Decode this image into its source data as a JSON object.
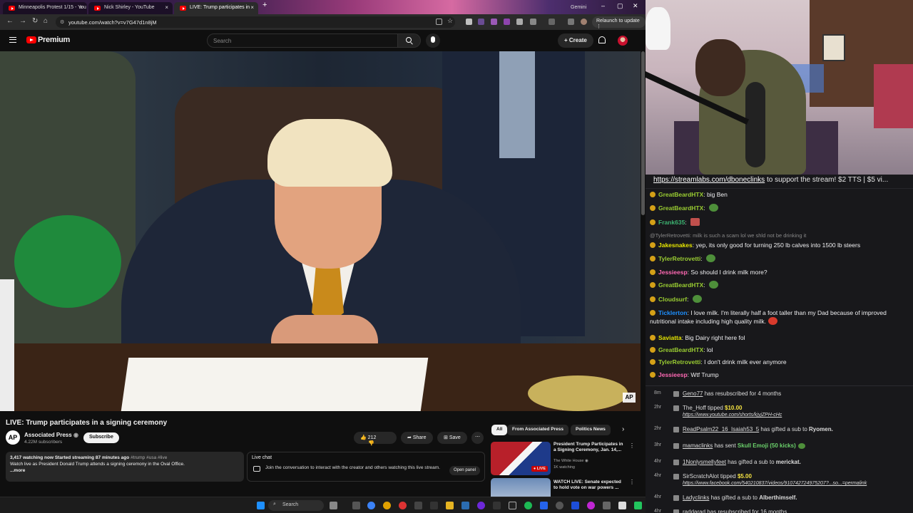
{
  "browser": {
    "tabs": [
      {
        "label": "Minneapolis Protest 1/15 - You"
      },
      {
        "label": "Nick Shirley - YouTube"
      },
      {
        "label": "LIVE: Trump participates in"
      },
      {
        "label": "Gemini"
      }
    ],
    "url": "youtube.com/watch?v=v7G47d1n8jM",
    "relaunch": "Relaunch to update"
  },
  "youtube": {
    "logo": "Premium",
    "search_placeholder": "Search",
    "create": "Create",
    "video_title": "LIVE: Trump participates in a signing ceremony",
    "channel": {
      "avatar": "AP",
      "name": "Associated Press",
      "subs": "4.22M subscribers",
      "subscribe": "Subscribe"
    },
    "actions": {
      "likes": "212",
      "share": "Share",
      "save": "Save"
    },
    "description": {
      "stats": "3,417 watching now  Started streaming 87 minutes ago",
      "tags": "#trump #usa #live",
      "text": "Watch live as President Donald Trump attends a signing ceremony in the Oval Office.",
      "more": "...more"
    },
    "live_chat": {
      "title": "Live chat",
      "desc": "Join the conversation to interact with the creator and others watching this live stream.",
      "button": "Open panel"
    },
    "chips": [
      "All",
      "From Associated Press",
      "Politics News"
    ],
    "recommendations": [
      {
        "title": "President Trump Participates in a Signing Ceremony, Jan. 14,...",
        "channel": "The White House",
        "meta": "1K watching",
        "badge": "LIVE"
      },
      {
        "title": "WATCH LIVE: Senate expected to hold vote on war powers ...",
        "channel": "",
        "meta": "",
        "badge": ""
      }
    ],
    "overlay": "AP"
  },
  "taskbar": {
    "search": "Search"
  },
  "chat": {
    "banner_link": "https://streamlabs.com/dboneclinks",
    "banner_text": " to support the stream! $2 TTS | $5 vi...",
    "messages": [
      {
        "user": "GreatBeardHTX",
        "text": "big Ben",
        "color": "#9acd32"
      },
      {
        "user": "GreatBeardHTX",
        "text": "",
        "color": "#9acd32"
      },
      {
        "user": "Frank635",
        "text": "",
        "color": "#3cb371"
      },
      {
        "user": "",
        "text": "@TylerRetrovetti: milk is such a scam lol we shld not be drinking it",
        "color": "#888888"
      },
      {
        "user": "Jakesnakes",
        "text": "yep, its only good for turning 250 lb calves into 1500 lb steers",
        "color": "#e6e600"
      },
      {
        "user": "TylerRetrovetti",
        "text": "",
        "color": "#9acd32"
      },
      {
        "user": "Jessieesp",
        "text": "So should I drink milk more?",
        "color": "#ff69b4"
      },
      {
        "user": "GreatBeardHTX",
        "text": "",
        "color": "#9acd32"
      },
      {
        "user": "Cloudsurf",
        "text": "",
        "color": "#9acd32"
      },
      {
        "user": "Ticklerton",
        "text": "I love milk. I'm literally half a foot taller than my Dad because of improved nutritional intake including high quality milk.",
        "color": "#1e90ff"
      },
      {
        "user": "Saviatta",
        "text": "Big Dairy right here fol",
        "color": "#e6e600"
      },
      {
        "user": "GreatBeardHTX",
        "text": "lol",
        "color": "#9acd32"
      },
      {
        "user": "TylerRetrovetti",
        "text": "I don't drink milk ever anymore",
        "color": "#9acd32"
      },
      {
        "user": "Jessieesp",
        "text": "Wtf Trump",
        "color": "#ff69b4"
      }
    ],
    "events": [
      {
        "time": "8m",
        "name": "Geno77",
        "text": " has resubscribed for 4 months"
      },
      {
        "time": "2hr",
        "name": "The_Hoff",
        "text": " tipped ",
        "amount": "$10.00",
        "link": "https://www.youtube.com/shorts/kjyjZPH-cHc"
      },
      {
        "time": "2hr",
        "name": "ReadPsalm22_16_Isaiah53_5",
        "text": " has gifted a sub to ",
        "target": "Ryomen."
      },
      {
        "time": "3hr",
        "name": "mamaclinks",
        "text": " has sent ",
        "item": "Skull Emoji (50 kicks)"
      },
      {
        "time": "4hr",
        "name": "1Nonlysmellyfeet",
        "text": " has gifted a sub to ",
        "target": "merickat."
      },
      {
        "time": "4hr",
        "name": "SirScratchAlot",
        "text": " tipped ",
        "amount": "$5.00",
        "link": "https://www.facebook.com/540210837/videos/910742724975207?...so...=permalink"
      },
      {
        "time": "4hr",
        "name": "Ladyclinks",
        "text": " has gifted a sub to ",
        "target": "Alberthimself."
      },
      {
        "time": "4hr",
        "name": "raddarad",
        "text": " has resubscribed for 16 months"
      }
    ]
  }
}
